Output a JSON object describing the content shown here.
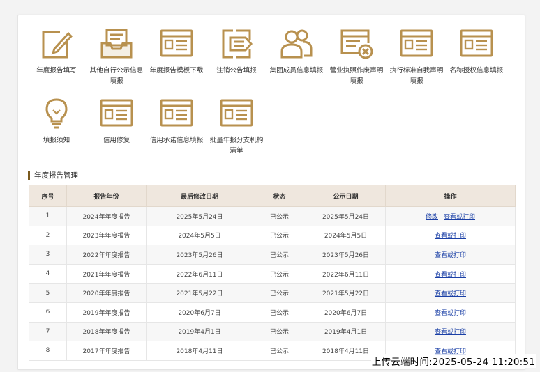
{
  "tiles": [
    {
      "label": "年度报告填写",
      "icon": "edit-document-icon"
    },
    {
      "label": "其他自行公示信息填报",
      "icon": "inbox-tray-icon"
    },
    {
      "label": "年度报告模板下载",
      "icon": "template-form-icon"
    },
    {
      "label": "注销公告填报",
      "icon": "cancel-notice-icon"
    },
    {
      "label": "集团成员信息填报",
      "icon": "group-members-icon"
    },
    {
      "label": "营业执照作废声明填报",
      "icon": "license-void-icon"
    },
    {
      "label": "执行标准自我声明填报",
      "icon": "standard-form-icon"
    },
    {
      "label": "名称授权信息填报",
      "icon": "name-auth-form-icon"
    },
    {
      "label": "填报须知",
      "icon": "lightbulb-icon"
    },
    {
      "label": "信用修复",
      "icon": "credit-repair-form-icon"
    },
    {
      "label": "信用承诺信息填报",
      "icon": "credit-promise-form-icon"
    },
    {
      "label": "批量年报分支机构清单",
      "icon": "batch-report-form-icon"
    }
  ],
  "section_title": "年度报告管理",
  "table": {
    "headers": [
      "序号",
      "报告年份",
      "最后修改日期",
      "状态",
      "公示日期",
      "操作"
    ],
    "rows": [
      {
        "no": "1",
        "year": "2024年年度报告",
        "modified": "2025年5月24日",
        "status": "已公示",
        "published": "2025年5月24日",
        "actions": [
          "修改",
          "查看或打印"
        ]
      },
      {
        "no": "2",
        "year": "2023年年度报告",
        "modified": "2024年5月5日",
        "status": "已公示",
        "published": "2024年5月5日",
        "actions": [
          "查看或打印"
        ]
      },
      {
        "no": "3",
        "year": "2022年年度报告",
        "modified": "2023年5月26日",
        "status": "已公示",
        "published": "2023年5月26日",
        "actions": [
          "查看或打印"
        ]
      },
      {
        "no": "4",
        "year": "2021年年度报告",
        "modified": "2022年6月11日",
        "status": "已公示",
        "published": "2022年6月11日",
        "actions": [
          "查看或打印"
        ]
      },
      {
        "no": "5",
        "year": "2020年年度报告",
        "modified": "2021年5月22日",
        "status": "已公示",
        "published": "2021年5月22日",
        "actions": [
          "查看或打印"
        ]
      },
      {
        "no": "6",
        "year": "2019年年度报告",
        "modified": "2020年6月7日",
        "status": "已公示",
        "published": "2020年6月7日",
        "actions": [
          "查看或打印"
        ]
      },
      {
        "no": "7",
        "year": "2018年年度报告",
        "modified": "2019年4月1日",
        "status": "已公示",
        "published": "2019年4月1日",
        "actions": [
          "查看或打印"
        ]
      },
      {
        "no": "8",
        "year": "2017年年度报告",
        "modified": "2018年4月11日",
        "status": "已公示",
        "published": "2018年4月11日",
        "actions": [
          "查看或打印"
        ]
      }
    ]
  },
  "upload_stamp": "上传云端时间:2025-05-24 11:20:51",
  "colors": {
    "icon_gold": "#b8914f",
    "link_blue": "#1a3fa6",
    "header_bg": "#efe7de"
  }
}
